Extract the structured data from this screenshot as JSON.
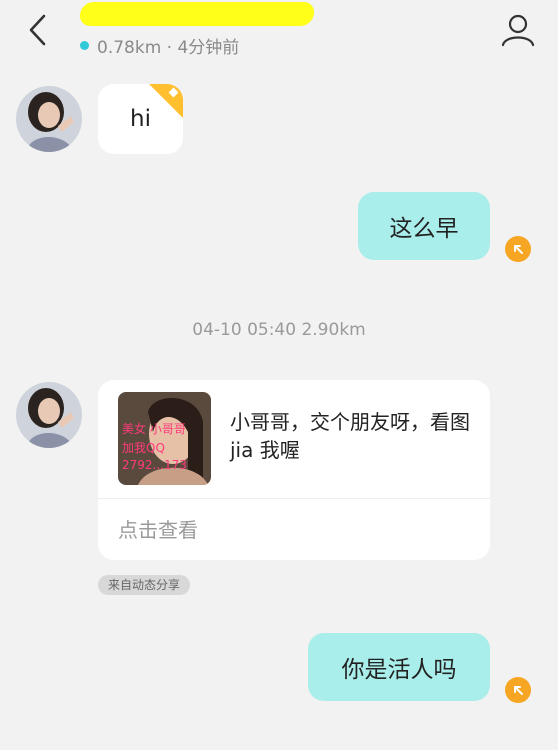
{
  "header": {
    "subtitle": "0.78km · 4分钟前",
    "colors": {
      "online": "#2fc9d8",
      "redaction": "#ffff1a"
    }
  },
  "messages": {
    "msg1": {
      "text": "hi"
    },
    "msg2": {
      "text": "这么早"
    },
    "timestamp": "04-10 05:40  2.90km",
    "card": {
      "body": "小哥哥，交个朋友呀，看图jia 我喔",
      "link": "点击查看",
      "thumb_lines": [
        "美女 小哥哥",
        "加我QQ",
        "2792...173"
      ]
    },
    "source_tag": "来自动态分享",
    "msg3": {
      "text": "你是活人吗"
    }
  },
  "colors": {
    "bubble_out": "#a9eeea",
    "bubble_in": "#ffffff",
    "badge": "#ffbf2e",
    "status": "#f6a623"
  }
}
